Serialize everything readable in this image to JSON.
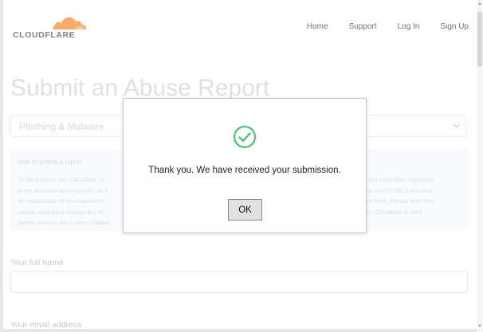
{
  "header": {
    "logo_text": "CLOUDFLARE",
    "nav": [
      "Home",
      "Support",
      "Log In",
      "Sign Up"
    ]
  },
  "main": {
    "title": "Submit an Abuse Report",
    "category_select": {
      "value": "Phishing & Malware"
    },
    "info": {
      "heading": "How to submit a report",
      "lines": [
        "To file a report with Cloudflare, pl",
        "in the form and be as specific as p",
        "An explanation of our approach t",
        "reports submitted through this fo",
        "parties such as the Lumen Databa"
      ],
      "lines_right": [
        "fill out each field requested",
        "it up to 250 URLs at a time.",
        "able here. Please note that",
        "d by Cloudflare to third",
        ""
      ]
    },
    "fields": [
      {
        "label": "Your full name",
        "value": ""
      },
      {
        "label": "Your email address",
        "value": ""
      }
    ]
  },
  "modal": {
    "message": "Thank you. We have received your submission.",
    "ok_label": "OK",
    "icon": "check-circle-icon"
  },
  "colors": {
    "brand_orange": "#f38020",
    "brand_orange_light": "#faae40",
    "success_green": "#4fc17a"
  }
}
